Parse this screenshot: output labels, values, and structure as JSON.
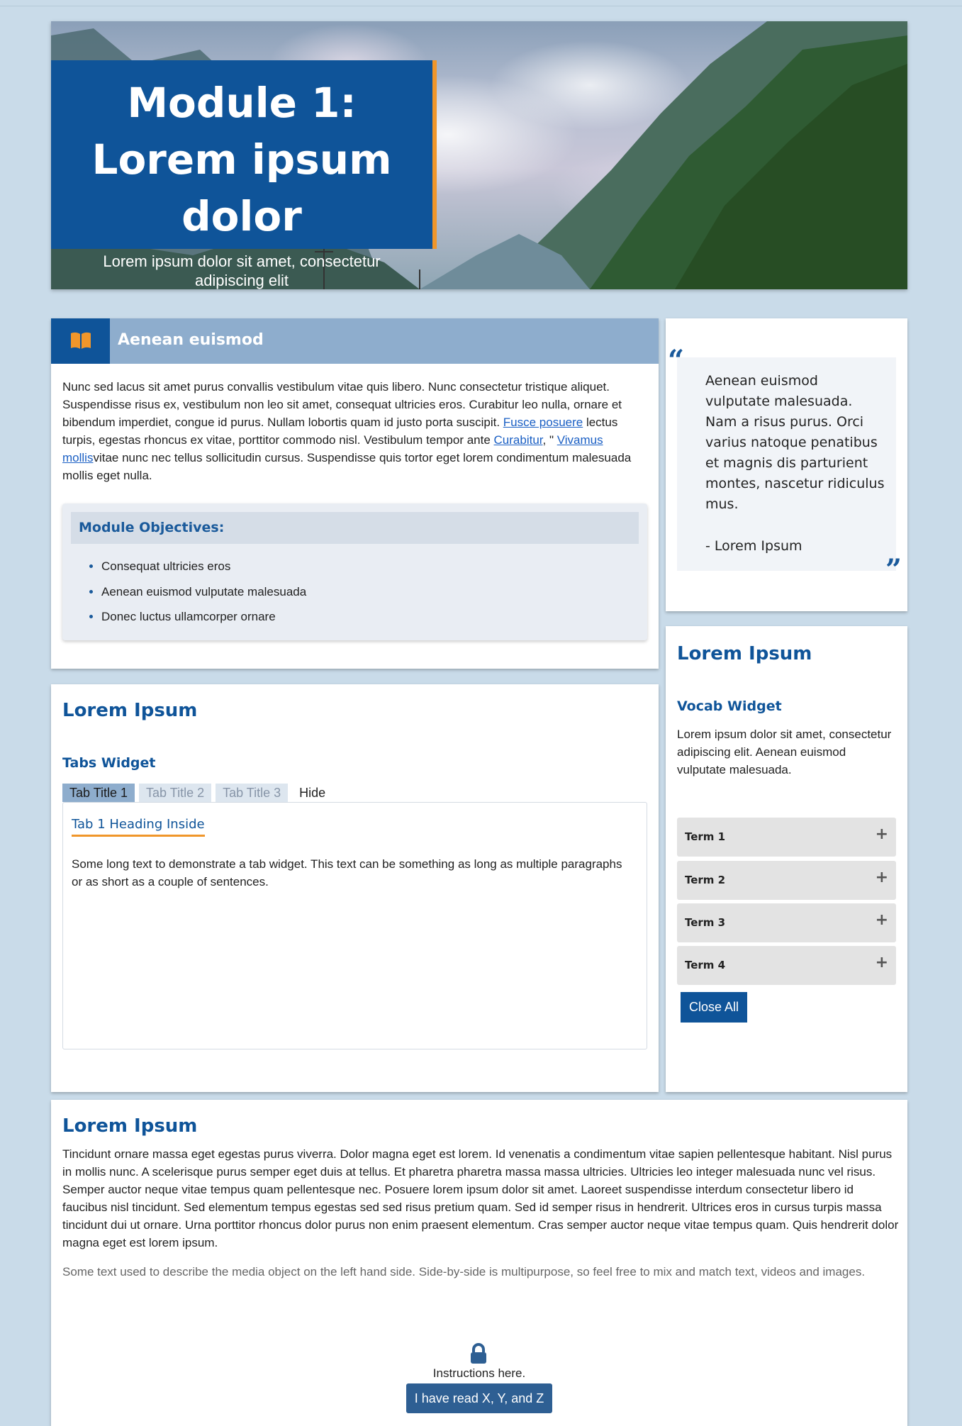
{
  "banner": {
    "title": "Module 1: Lorem ipsum dolor",
    "subtitle": "Lorem ipsum dolor sit amet, consectetur adipiscing elit"
  },
  "intro": {
    "heading": "Aenean euismod",
    "icon": "book-icon",
    "para_segments": [
      "Nunc sed lacus sit amet purus convallis vestibulum vitae quis libero. Nunc consectetur tristique aliquet. Suspendisse risus ex, vestibulum non leo sit amet, consequat ultricies eros. Curabitur leo nulla, ornare et bibendum imperdiet, congue id purus. Nullam lobortis quam id justo porta suscipit. ",
      "Fusce posuere",
      " lectus turpis, egestas rhoncus ex vitae, porttitor commodo nisl. Vestibulum tempor ante ",
      "Curabitur",
      ", \" ",
      "Vivamus mollis",
      "vitae nunc nec tellus sollicitudin cursus. Suspendisse quis tortor eget lorem condimentum malesuada mollis eget nulla."
    ],
    "objectives_title": "Module Objectives:",
    "objectives": [
      "Consequat ultricies eros",
      "Aenean euismod vulputate malesuada",
      "Donec luctus ullamcorper ornare"
    ]
  },
  "quote": {
    "open_mark": "“",
    "close_mark": "”",
    "text": "Aenean euismod vulputate malesuada. Nam a risus purus. Orci varius natoque penatibus et magnis dis parturient montes, nascetur ridiculus mus.",
    "attribution": "- Lorem Ipsum"
  },
  "tabs_section": {
    "title": "Lorem Ipsum",
    "widget_title": "Tabs Widget",
    "tabs": [
      "Tab Title 1",
      "Tab Title 2",
      "Tab Title 3"
    ],
    "hide_label": "Hide",
    "active_tab": 0,
    "panel_heading": "Tab 1 Heading Inside",
    "panel_text": "Some long text to demonstrate a tab widget. This text can be something as long as multiple paragraphs or as short as a couple of sentences."
  },
  "vocab": {
    "title": "Lorem Ipsum",
    "widget_title": "Vocab Widget",
    "description": "Lorem ipsum dolor sit amet, consectetur adipiscing elit. Aenean euismod vulputate malesuada.",
    "terms": [
      "Term 1",
      "Term 2",
      "Term 3",
      "Term 4"
    ],
    "expand_symbol": "+",
    "close_all_label": "Close All"
  },
  "bottom": {
    "title": "Lorem Ipsum",
    "paragraph": "Tincidunt ornare massa eget egestas purus viverra. Dolor magna eget est lorem. Id venenatis a condimentum vitae sapien pellentesque habitant. Nisl purus in mollis nunc. A scelerisque purus semper eget duis at tellus. Et pharetra pharetra massa massa ultricies. Ultricies leo integer malesuada nunc vel risus. Semper auctor neque vitae tempus quam pellentesque nec. Posuere lorem ipsum dolor sit amet. Laoreet suspendisse interdum consectetur libero id faucibus nisl tincidunt. Sed elementum tempus egestas sed sed risus pretium quam. Sed id semper risus in hendrerit. Ultrices eros in cursus turpis massa tincidunt dui ut ornare. Urna porttitor rhoncus dolor purus non enim praesent elementum. Cras semper auctor neque vitae tempus quam. Quis hendrerit dolor magna eget est lorem ipsum.",
    "media_text": "Some text used to describe the media object on the left hand side. Side-by-side is multipurpose, so feel free to mix and match text, videos and images.",
    "lock_icon": "lock-icon",
    "instructions": "Instructions here.",
    "button_label": "I have read X, Y, and Z"
  },
  "colors": {
    "page_bg": "#c9dbe9",
    "brand_blue": "#0f5499",
    "accent_orange": "#f0962a",
    "header_band": "#8eadcd"
  }
}
